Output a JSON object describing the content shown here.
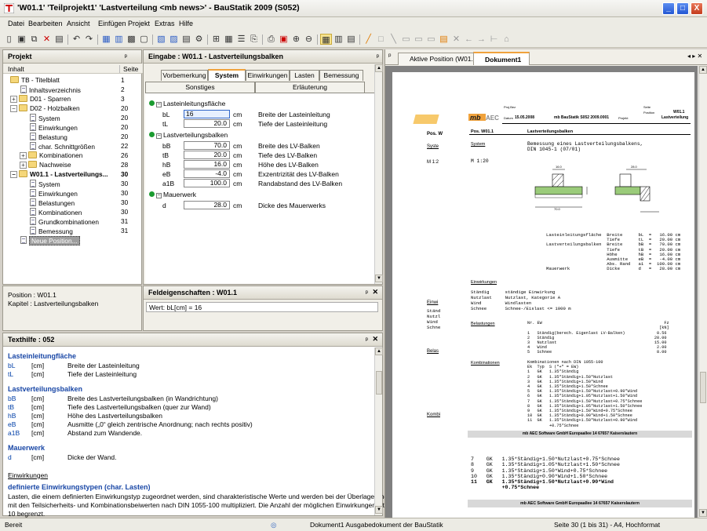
{
  "window": {
    "title": "'W01.1' 'Teilprojekt1' 'Lastverteilung <mb news>' - BauStatik 2009 (S052)",
    "min": "_",
    "max": "□",
    "close": "X"
  },
  "menu": [
    "Datei",
    "Bearbeiten",
    "Ansicht",
    "Einfügen",
    "Projekt",
    "Extras",
    "Hilfe"
  ],
  "project": {
    "title": "Projekt",
    "pin": "ᵖ",
    "col_content": "Inhalt",
    "col_page": "Seite",
    "rows": [
      {
        "label": "TB - Titelblatt",
        "page": "1"
      },
      {
        "label": "Inhaltsverzeichnis",
        "page": "2"
      },
      {
        "label": "D01 - Sparren",
        "page": "3"
      },
      {
        "label": "D02 - Holzbalken",
        "page": "20"
      },
      {
        "label": "System",
        "page": "20"
      },
      {
        "label": "Einwirkungen",
        "page": "20"
      },
      {
        "label": "Belastung",
        "page": "20"
      },
      {
        "label": "char. Schnittgrößen",
        "page": "22"
      },
      {
        "label": "Kombinationen",
        "page": "26"
      },
      {
        "label": "Nachweise",
        "page": "28"
      },
      {
        "label": "W01.1 - Lastverteilungs...",
        "page": "30"
      },
      {
        "label": "System",
        "page": "30"
      },
      {
        "label": "Einwirkungen",
        "page": "30"
      },
      {
        "label": "Belastungen",
        "page": "30"
      },
      {
        "label": "Kombinationen",
        "page": "30"
      },
      {
        "label": "Grundkombinationen",
        "page": "31"
      },
      {
        "label": "Bemessung",
        "page": "31"
      },
      {
        "label": "Neue Position...",
        "page": ""
      }
    ],
    "info_position": "Position : W01.1",
    "info_chapter": "Kapitel : Lastverteilungsbalken"
  },
  "input": {
    "title": "Eingabe : W01.1 - Lastverteilungsbalken",
    "tabs1": [
      "Vorbemerkung",
      "System",
      "Einwirkungen",
      "Lasten",
      "Bemessung"
    ],
    "tabs2": [
      "Sonstiges",
      "Erläuterung"
    ],
    "groups": [
      {
        "label": "Lasteinleitungsfläche",
        "fields": [
          {
            "name": "bL",
            "value": "16",
            "unit": "cm",
            "desc": "Breite der Lasteinleitung"
          },
          {
            "name": "tL",
            "value": "20.0",
            "unit": "cm",
            "desc": "Tiefe der Lasteinleitung"
          }
        ]
      },
      {
        "label": "Lastverteilungsbalken",
        "fields": [
          {
            "name": "bB",
            "value": "70.0",
            "unit": "cm",
            "desc": "Breite des LV-Balken"
          },
          {
            "name": "tB",
            "value": "20.0",
            "unit": "cm",
            "desc": "Tiefe des LV-Balken"
          },
          {
            "name": "hB",
            "value": "16.0",
            "unit": "cm",
            "desc": "Höhe des LV-Balken"
          },
          {
            "name": "eB",
            "value": "-4.0",
            "unit": "cm",
            "desc": "Exzentrizität des LV-Balken"
          },
          {
            "name": "a1B",
            "value": "100.0",
            "unit": "cm",
            "desc": "Randabstand des LV-Balken"
          }
        ]
      },
      {
        "label": "Mauerwerk",
        "fields": [
          {
            "name": "d",
            "value": "28.0",
            "unit": "cm",
            "desc": "Dicke des Mauerwerks"
          }
        ]
      }
    ]
  },
  "field_props": {
    "title": "Feldeigenschaften : W01.1",
    "value": "Wert: bL[cm] = 16"
  },
  "texthilfe": {
    "title": "Texthilfe : 052",
    "sec1": "Lasteinleitungfläche",
    "rows1": [
      {
        "n": "bL",
        "u": "[cm]",
        "d": "Breite der Lasteinleitung"
      },
      {
        "n": "tL",
        "u": "[cm]",
        "d": "Tiefe der Lasteinleitung"
      }
    ],
    "sec2": "Lastverteilungsbalken",
    "rows2": [
      {
        "n": "bB",
        "u": "[cm]",
        "d": "Breite des Lastverteilungsbalken (in Wandrichtung)"
      },
      {
        "n": "tB",
        "u": "[cm]",
        "d": "Tiefe des Lastverteilungsbalken (quer zur Wand)"
      },
      {
        "n": "hB",
        "u": "[cm]",
        "d": "Höhe des Lastverteilungsbalken"
      },
      {
        "n": "eB",
        "u": "[cm]",
        "d": "Ausmitte („0“ gleich zentrische Anordnung; nach rechts positiv)"
      },
      {
        "n": "a1B",
        "u": "[cm]",
        "d": "Abstand zum Wandende."
      }
    ],
    "sec3": "Mauerwerk",
    "rows3": [
      {
        "n": "d",
        "u": "[cm]",
        "d": "Dicke der Wand."
      }
    ],
    "link": "Einwirkungen",
    "sec4": "definierte Einwirkungstypen (char. Lasten)",
    "para1": "Lasten, die einem definierten Einwirkungstyp zugeordnet werden, sind charakteristische Werte und werden bei der Überlagerung",
    "para2": "mit den Teilsicherheits- und Kombinationsbeiwerten nach DIN 1055-100 multipliziert. Die Anzahl der möglichen Einwirkungen ist auf",
    "para3": "10 begrenzt."
  },
  "doctabs": [
    "Aktive Position (W01.1)",
    "Dokument1"
  ],
  "doc": {
    "hdr": {
      "projbez": "Proj.Bez",
      "datum_lbl": "Datum",
      "datum": "15.05.2008",
      "prod": "mb BauStatik S052  2009.0001",
      "projekt": "Projekt",
      "seite": "Seite",
      "position": "Position",
      "pos": "W01.1",
      "kap": "Lastverteilung"
    },
    "pos_lbl": "Pos. W01.1",
    "pos_title": "Lastverteilungsbalken",
    "sys_lbl": "System",
    "sys_text": "Bemessung eines Lastverteilungsbalkens,\nDIN 1045-1 (07/01)",
    "scale": "M 1:20",
    "dims_t": "Lasteinleitungsfläche  Breite      bL  =   16.00 cm\n                       Tiefe       tL  =   20.00 cm\nLastverteilungsbalken  Breite      bB  =   70.00 cm\n                       Tiefe       tB  =   20.00 cm\n                       Höhe        hB  =   16.00 cm\n                       Ausmitte    eB  =   -4.00 cm\n                       Abs. Rand   a1  =  100.00 cm\nMauerwerk              Dicke       d   =   28.00 cm",
    "einw_lbl": "Einwirkungen",
    "einw_t": "Ständig      ständige Einwirkung\nNutzlast     Nutzlast, Kategorie A\nWind         Windlasten\nSchnee       Schnee-/Eislast <= 1000 m",
    "bel_lbl": "Belastungen",
    "bel_hdr": "Nr. EW                                                  Fz\n                                                      [kN]",
    "bel_t": "1   Ständig(berech. Eigenlast LV-Balken)             0.56\n2   Ständig                                         20.00\n3   Nutzlast                                        15.00\n4   Wind                                             2.00\n5   Schnee                                           8.00",
    "kombi_lbl": "Kombinationen",
    "kombi_t": "Kombinationen nach DIN 1055-100\nEk  Typ  S (\"+\" = EW)\n1   GK   1.35*Ständig\n2   GK   1.35*Ständig+1.50*Nutzlast\n3   GK   1.35*Ständig+1.50*Wind\n4   GK   1.35*Ständig+1.50*Schnee\n5   GK   1.35*Ständig+1.50*Nutzlast+0.90*Wind\n6   GK   1.35*Ständig+1.05*Nutzlast+1.50*Wind\n7   GK   1.35*Ständig+1.50*Nutzlast+0.75*Schnee\n8   GK   1.35*Ständig+1.05*Nutzlast+1.50*Schnee\n9   GK   1.35*Ständig+1.50*Wind+0.75*Schnee\n10  GK   1.35*Ständig+0.90*Wind+1.50*Schnee\n11  GK   1.35*Ständig+1.50*Nutzlast+0.90*Wind\n         +0.75*Schnee",
    "footer": "mb AEC Software GmbH   Europaallee 14   67657 Kaiserslautern",
    "big_t": "7    GK   1.35*Ständig+1.50*Nutzlast+0.75*Schnee\n8    GK   1.35*Ständig+1.05*Nutzlast+1.50*Schnee\n9    GK   1.35*Ständig+1.50*Wind+0.75*Schnee\n10   GK   1.35*Ständig+0.90*Wind+1.50*Schnee",
    "big_11": "11   GK   1.35*Ständig+1.50*Nutzlast+0.90*Wind\n          +0.75*Schnee",
    "footer2": "mb AEC Software GmbH   Europaallee 14   67657 Kaiserslautern",
    "left_pos": "Pos. W",
    "left_sys": "Syste",
    "left_scale": "M 1:2",
    "left_einw": "Einwi",
    "left_einw_t": "Ständ\nNutzl\nWind\nSchne",
    "left_bel": "Belas",
    "left_kombi": "Kombi",
    "dim_top": "16.0",
    "dim_side": "20.0",
    "dim_bot": "70.0",
    "dim_r": "28.0"
  },
  "status": {
    "left": "Bereit",
    "doc": "Dokument1  Ausgabedokument der BauStatik",
    "page": "Seite 30 (1 bis 31) - A4, Hochformat"
  },
  "colors": {
    "accent": "#1947a6",
    "tab_orange": "#f0a23c",
    "green": "#1a9b2f"
  }
}
